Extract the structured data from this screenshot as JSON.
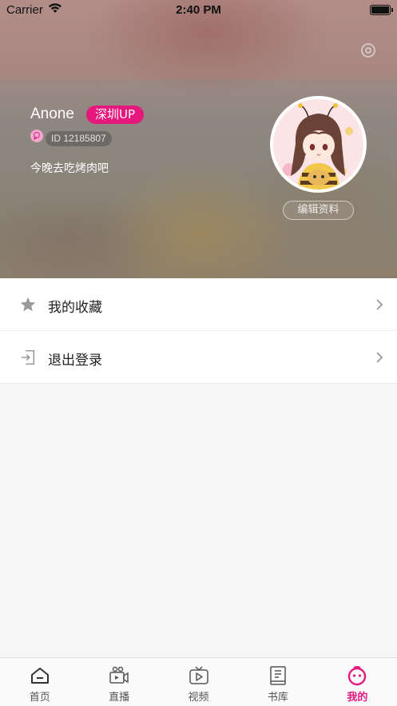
{
  "status_bar": {
    "carrier": "Carrier",
    "time": "2:40 PM",
    "icons": [
      "wifi-icon",
      "battery-icon"
    ]
  },
  "profile": {
    "username": "Anone",
    "city_badge": "深圳UP",
    "id_text": "ID 12185807",
    "signature": "今晚去吃烤肉吧",
    "edit_button": "编辑资料",
    "badge_color": "#e6187e"
  },
  "menu": {
    "items": [
      {
        "label": "我的收藏",
        "icon": "star-icon"
      },
      {
        "label": "退出登录",
        "icon": "logout-icon"
      }
    ]
  },
  "tabbar": {
    "accent_color": "#e6187e",
    "active_tab": "我的",
    "tabs": [
      {
        "label": "首页",
        "icon": "home-icon"
      },
      {
        "label": "直播",
        "icon": "live-camera-icon"
      },
      {
        "label": "视频",
        "icon": "video-play-icon"
      },
      {
        "label": "书库",
        "icon": "book-icon"
      },
      {
        "label": "我的",
        "icon": "profile-face-icon"
      }
    ]
  }
}
